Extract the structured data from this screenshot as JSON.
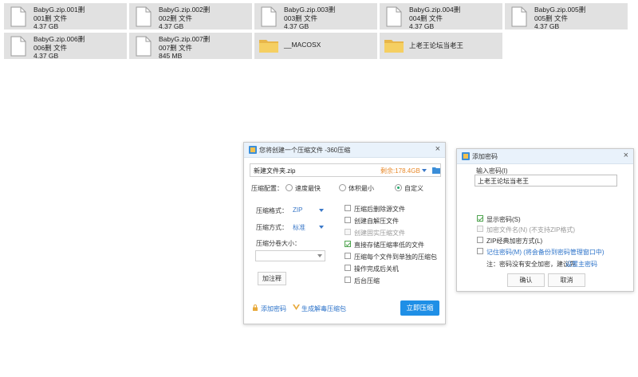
{
  "files": [
    {
      "name": "BabyG.zip.001删",
      "line2": "001删 文件",
      "size": "4.37 GB"
    },
    {
      "name": "BabyG.zip.002删",
      "line2": "002删 文件",
      "size": "4.37 GB"
    },
    {
      "name": "BabyG.zip.003删",
      "line2": "003删 文件",
      "size": "4.37 GB"
    },
    {
      "name": "BabyG.zip.004删",
      "line2": "004删 文件",
      "size": "4.37 GB"
    },
    {
      "name": "BabyG.zip.005删",
      "line2": "005删 文件",
      "size": "4.37 GB"
    },
    {
      "name": "BabyG.zip.006删",
      "line2": "006删 文件",
      "size": "4.37 GB"
    },
    {
      "name": "BabyG.zip.007删",
      "line2": "007删 文件",
      "size": "845 MB"
    }
  ],
  "folders": [
    "__MACOSX",
    "上老王论坛当老王"
  ],
  "compress_dialog": {
    "title": "您将创建一个压缩文件 -360压缩",
    "filename": "新建文件夹.zip",
    "remaining": "剩余:178.4GB",
    "config_label": "压缩配置：",
    "radio_options": [
      "速度最快",
      "体积最小",
      "自定义"
    ],
    "format_label": "压缩格式：",
    "format_value": "ZIP",
    "method_label": "压缩方式：",
    "method_value": "标准",
    "split_label": "压缩分卷大小：",
    "split_value": "",
    "comment_button": "加注释",
    "options": [
      {
        "label": "压缩后删除源文件",
        "checked": false,
        "disabled": false
      },
      {
        "label": "创建自解压文件",
        "checked": false,
        "disabled": false
      },
      {
        "label": "创建固实压缩文件",
        "checked": false,
        "disabled": true
      },
      {
        "label": "直接存储压缩率低的文件",
        "checked": true,
        "disabled": false
      },
      {
        "label": "压缩每个文件到单独的压缩包",
        "checked": false,
        "disabled": false
      },
      {
        "label": "操作完成后关机",
        "checked": false,
        "disabled": false
      },
      {
        "label": "后台压缩",
        "checked": false,
        "disabled": false
      }
    ],
    "add_password_link": "添加密码",
    "anti_virus_link": "生成解毒压缩包",
    "submit": "立即压缩"
  },
  "password_dialog": {
    "title": "添加密码",
    "input_label": "输入密码(I)",
    "input_value": "上老王论坛当老王",
    "show_password": "显示密码(S)",
    "encrypt_names": "加密文件名(N) (不支持ZIP格式)",
    "zip_classic": "ZIP经典加密方式(L)",
    "remember_password": "记住密码(M) (将会备份到密码管理窗口中)",
    "note_prefix": "注：密码没有安全加密，建议先",
    "note_link": "设置主密码",
    "ok": "确认",
    "cancel": "取消"
  },
  "colors": {
    "accent": "#1f8fe6",
    "check": "#4fa44f",
    "orange": "#e8892a",
    "tile": "#e1e1e1"
  }
}
